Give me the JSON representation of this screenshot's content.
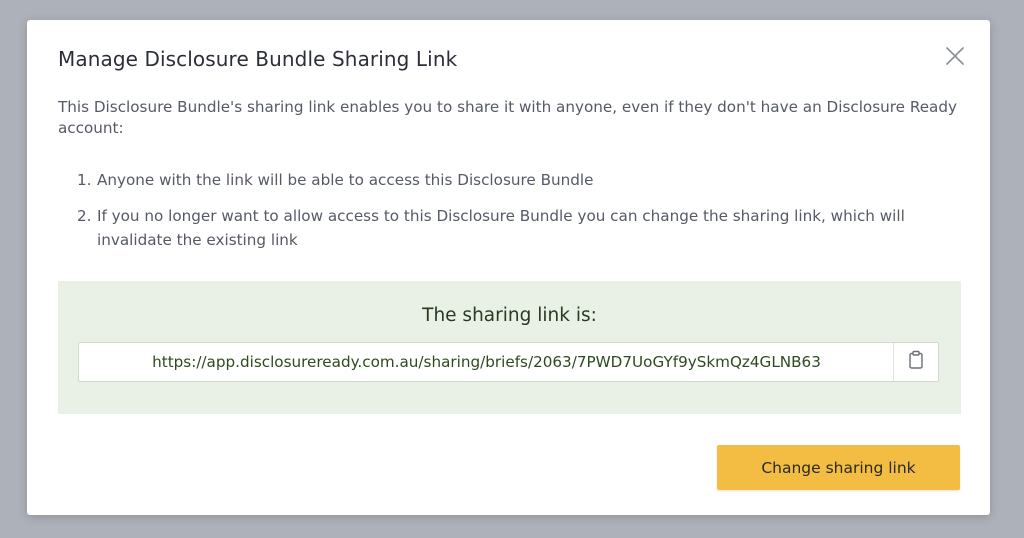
{
  "dialog": {
    "title": "Manage Disclosure Bundle Sharing Link",
    "close_icon": "close-icon",
    "intro": "This Disclosure Bundle's sharing link enables you to share it with anyone, even if they don't have an Disclosure Ready account:",
    "steps": [
      {
        "number": "1.",
        "text": "Anyone with the link will be able to access this Disclosure Bundle"
      },
      {
        "number": "2.",
        "text": "If you no longer want to allow access to this Disclosure Bundle you can change the sharing link, which will invalidate the existing link"
      }
    ],
    "link_panel": {
      "heading": "The sharing link is:",
      "url": "https://app.disclosureready.com.au/sharing/briefs/2063/7PWD7UoGYf9ySkmQz4GLNB63",
      "copy_icon": "clipboard-icon"
    },
    "primary_button_label": "Change sharing link"
  },
  "colors": {
    "backdrop": "#adb1b9",
    "panel_background": "#e9f1e6",
    "link_text": "#2e4a1f",
    "primary_button": "#f2bd42"
  }
}
